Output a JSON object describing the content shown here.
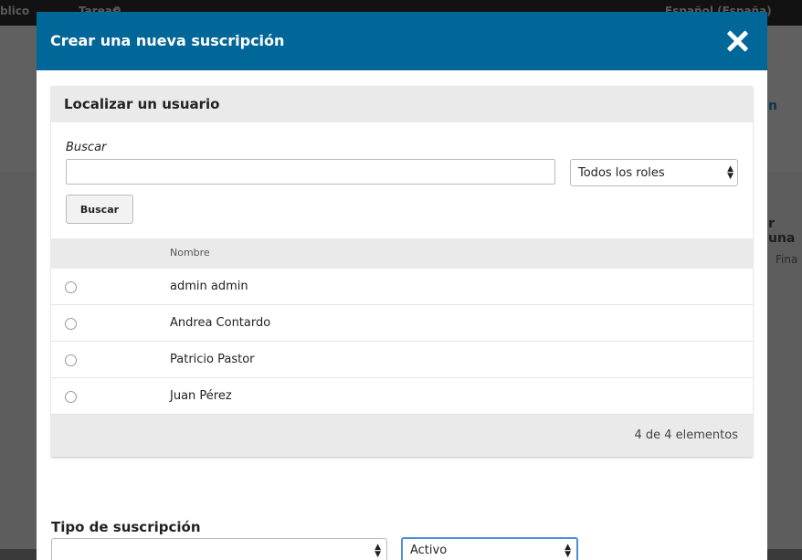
{
  "background": {
    "topbar_left": "blico",
    "topbar_tasks": "Tareas",
    "topbar_tasks_count": "0",
    "topbar_language": "Español (España)",
    "right_link": "n",
    "right_heading": "r una",
    "right_column": "Fina"
  },
  "modal": {
    "title": "Crear una nueva suscripción",
    "header_color": "#006798"
  },
  "locate_user": {
    "title": "Localizar un usuario",
    "search_label": "Buscar",
    "search_value": "",
    "roles_selected": "Todos los roles",
    "search_button": "Buscar",
    "column_name": "Nombre",
    "rows": [
      {
        "name": "admin admin"
      },
      {
        "name": "Andrea Contardo"
      },
      {
        "name": "Patricio Pastor"
      },
      {
        "name": "Juan Pérez"
      }
    ],
    "count": "4 de 4 elementos"
  },
  "subscription": {
    "type_label": "Tipo de suscripción",
    "type_value": "",
    "status_value": "Activo"
  },
  "icons": {
    "close": "close-icon",
    "radio": "radio-icon",
    "select_arrow": "chevron-updown-icon"
  }
}
